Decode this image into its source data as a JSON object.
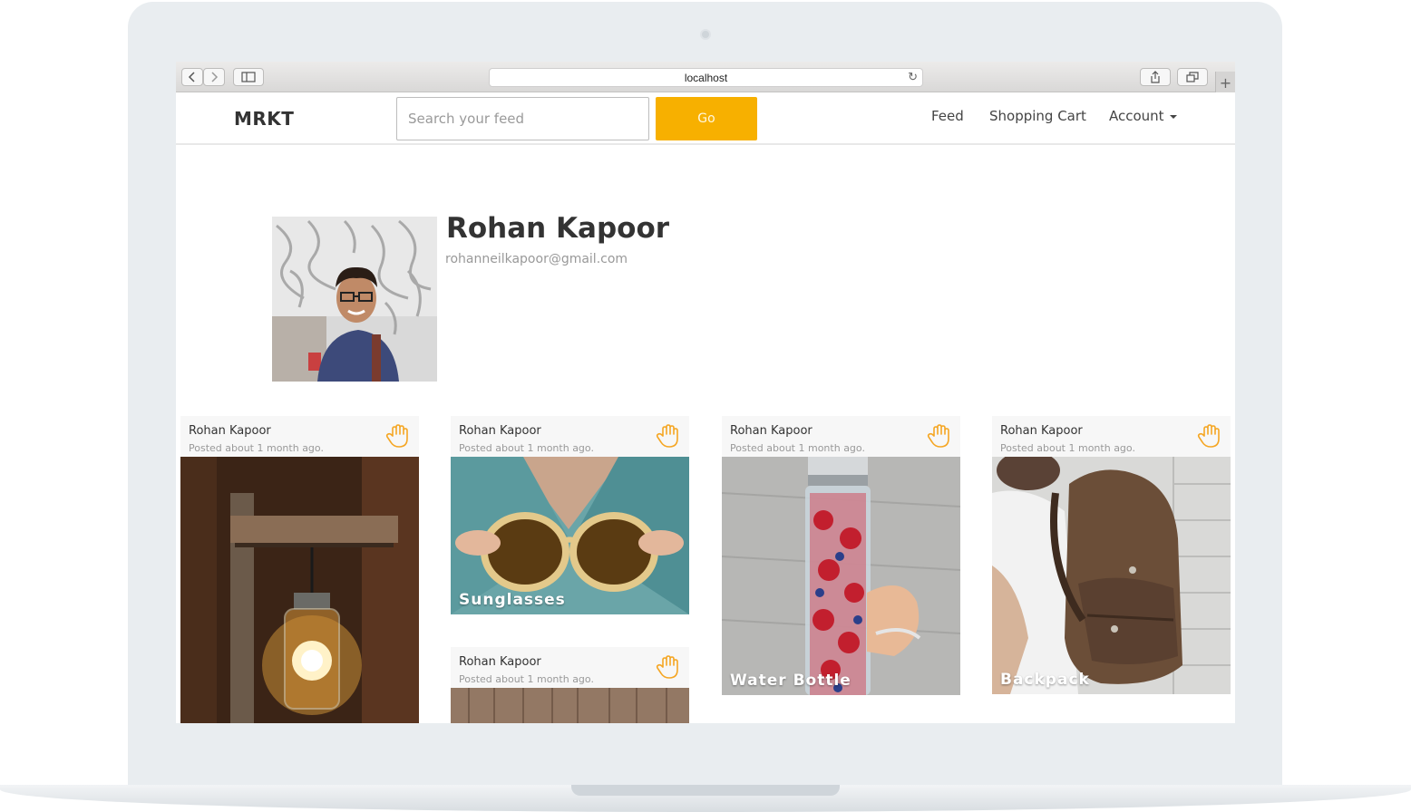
{
  "browser": {
    "url": "localhost"
  },
  "navbar": {
    "brand": "MRKT",
    "search_placeholder": "Search your feed",
    "go_label": "Go",
    "links": [
      "Feed",
      "Shopping Cart",
      "Account"
    ]
  },
  "profile": {
    "name": "Rohan Kapoor",
    "email": "rohanneilkapoor@gmail.com"
  },
  "posts": [
    {
      "author": "Rohan Kapoor",
      "time": "Posted about 1 month ago.",
      "title": ""
    },
    {
      "author": "Rohan Kapoor",
      "time": "Posted about 1 month ago.",
      "title": "Sunglasses"
    },
    {
      "author": "Rohan Kapoor",
      "time": "Posted about 1 month ago.",
      "title": ""
    },
    {
      "author": "Rohan Kapoor",
      "time": "Posted about 1 month ago.",
      "title": "Water Bottle"
    },
    {
      "author": "Rohan Kapoor",
      "time": "Posted about 1 month ago.",
      "title": "Backpack"
    }
  ],
  "colors": {
    "accent": "#f7b000",
    "hand_icon": "#f5a623"
  },
  "icons": {
    "post_action": "hand-icon"
  }
}
